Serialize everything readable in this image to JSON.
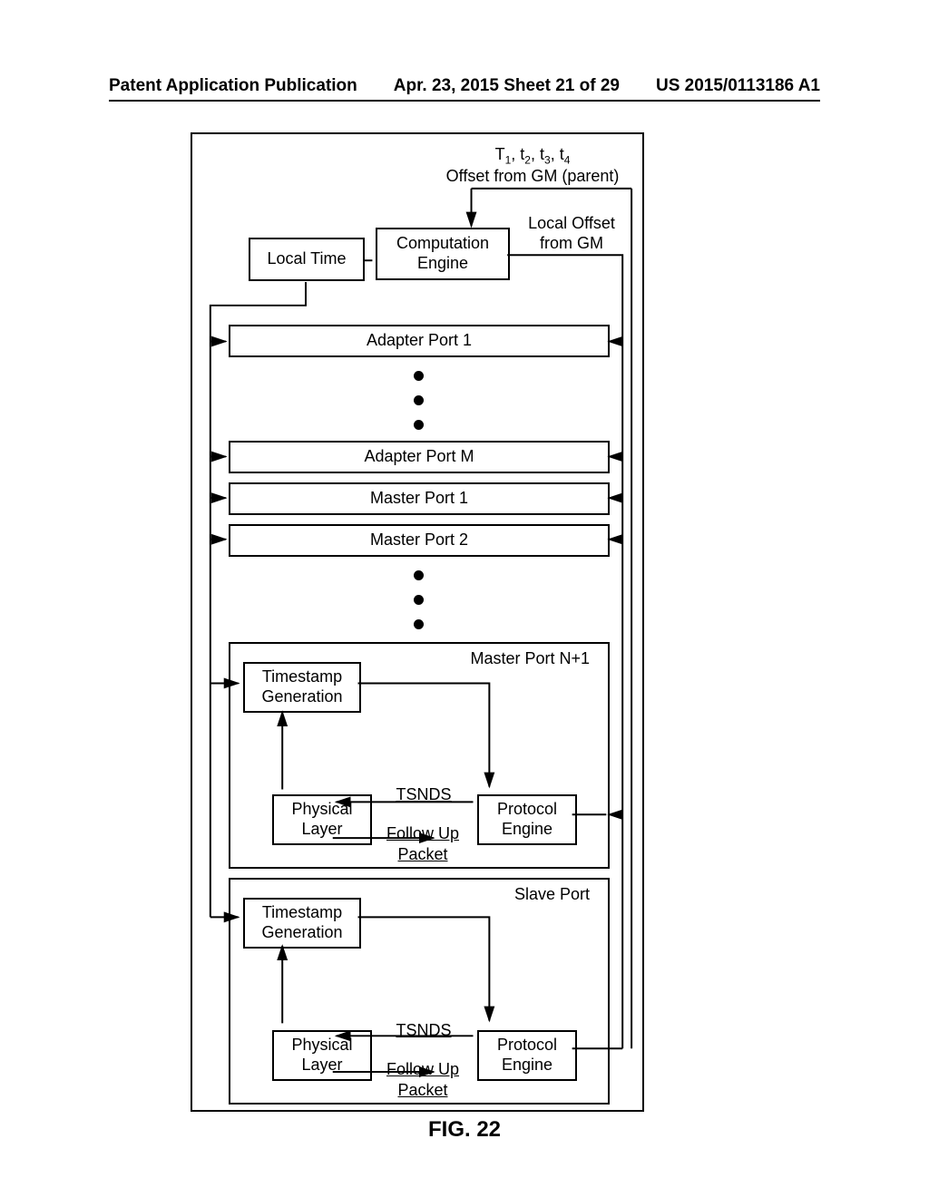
{
  "header": {
    "left": "Patent Application Publication",
    "center": "Apr. 23, 2015  Sheet 21 of 29",
    "right": "US 2015/0113186 A1"
  },
  "topAnnotation": {
    "line1_html": "T<span class='sub'>1</span>, t<span class='sub'>2</span>, t<span class='sub'>3</span>, t<span class='sub'>4</span>",
    "line2": "Offset from GM (parent)"
  },
  "localTime": "Local Time",
  "compEngine": "Computation Engine",
  "localOffset": "Local Offset from GM",
  "ports": {
    "adapter1": "Adapter Port 1",
    "adapterM": "Adapter Port M",
    "master1": "Master Port 1",
    "master2": "Master Port 2"
  },
  "masterPortN1": {
    "title": "Master Port N+1",
    "tsGen": "Timestamp Generation",
    "physical": "Physical Layer",
    "protocol": "Protocol Engine",
    "tsnds": "TSNDS",
    "followup": "Follow Up",
    "packet": "Packet"
  },
  "slavePort": {
    "title": "Slave Port",
    "tsGen": "Timestamp Generation",
    "physical": "Physical Layer",
    "protocol": "Protocol Engine",
    "tsnds": "TSNDS",
    "followup": "Follow Up",
    "packet": "Packet"
  },
  "figLabel": "FIG. 22"
}
